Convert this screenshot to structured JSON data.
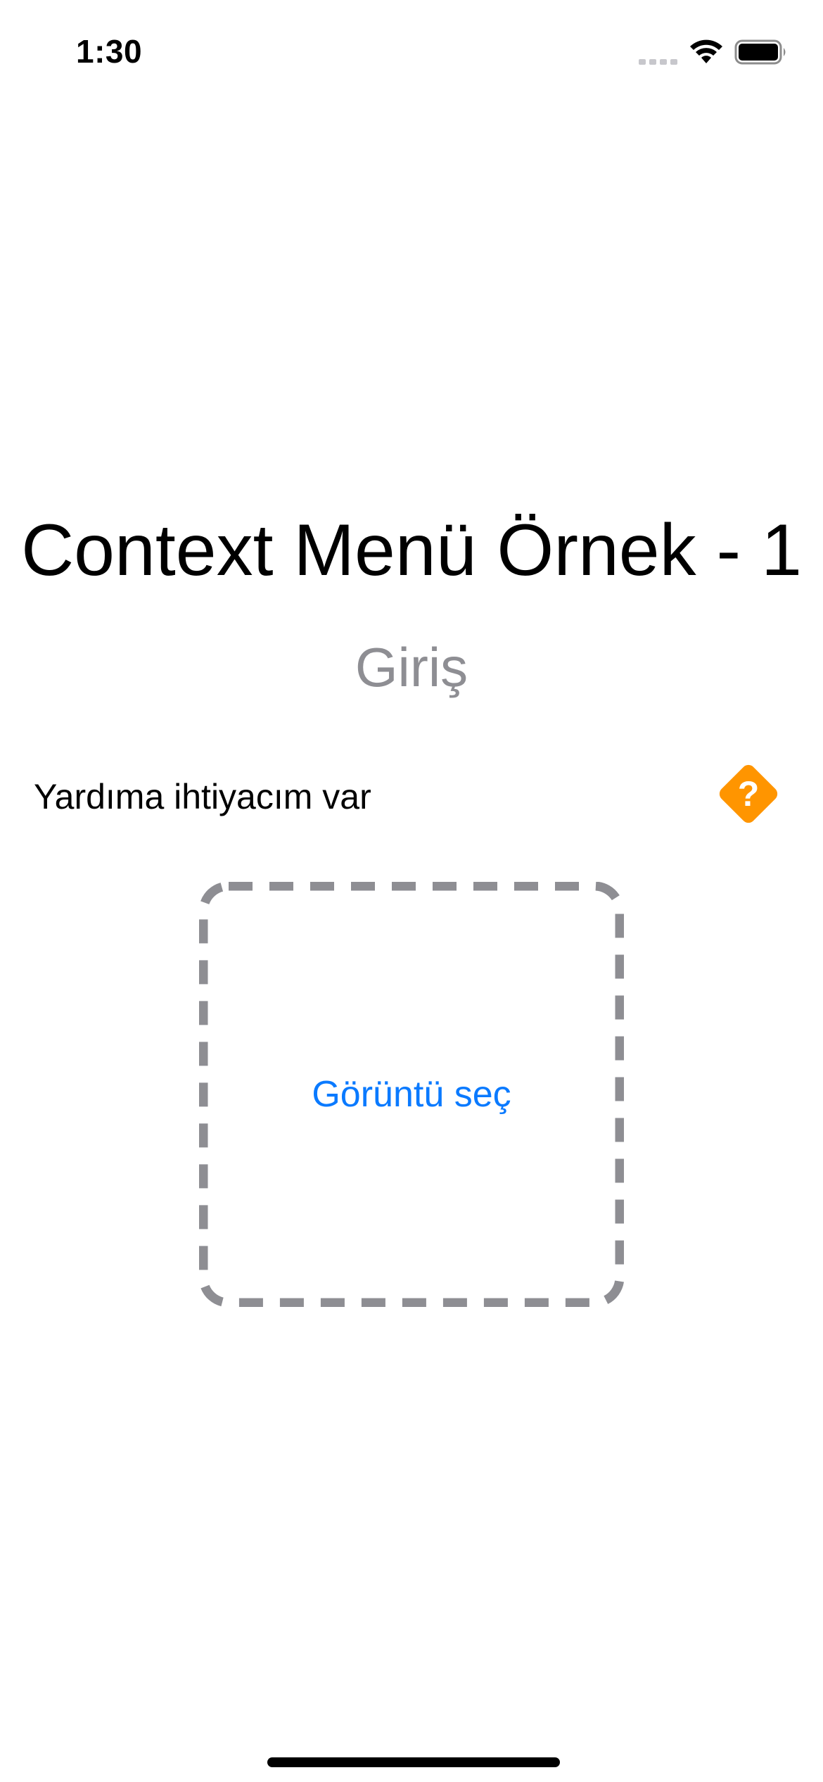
{
  "status_bar": {
    "time": "1:30",
    "signal_icon": "cellular-signal-icon",
    "wifi_icon": "wifi-icon",
    "battery_icon": "battery-icon"
  },
  "main": {
    "title": "Context Menü Örnek - 1",
    "subtitle": "Giriş",
    "help_row": {
      "label": "Yardıma ihtiyacım var",
      "icon": "question-diamond-icon",
      "icon_color": "#ff9500",
      "icon_glyph": "?"
    },
    "image_picker": {
      "label": "Görüntü seç",
      "border_color": "#8e8e93",
      "label_color": "#0a7aff"
    }
  }
}
